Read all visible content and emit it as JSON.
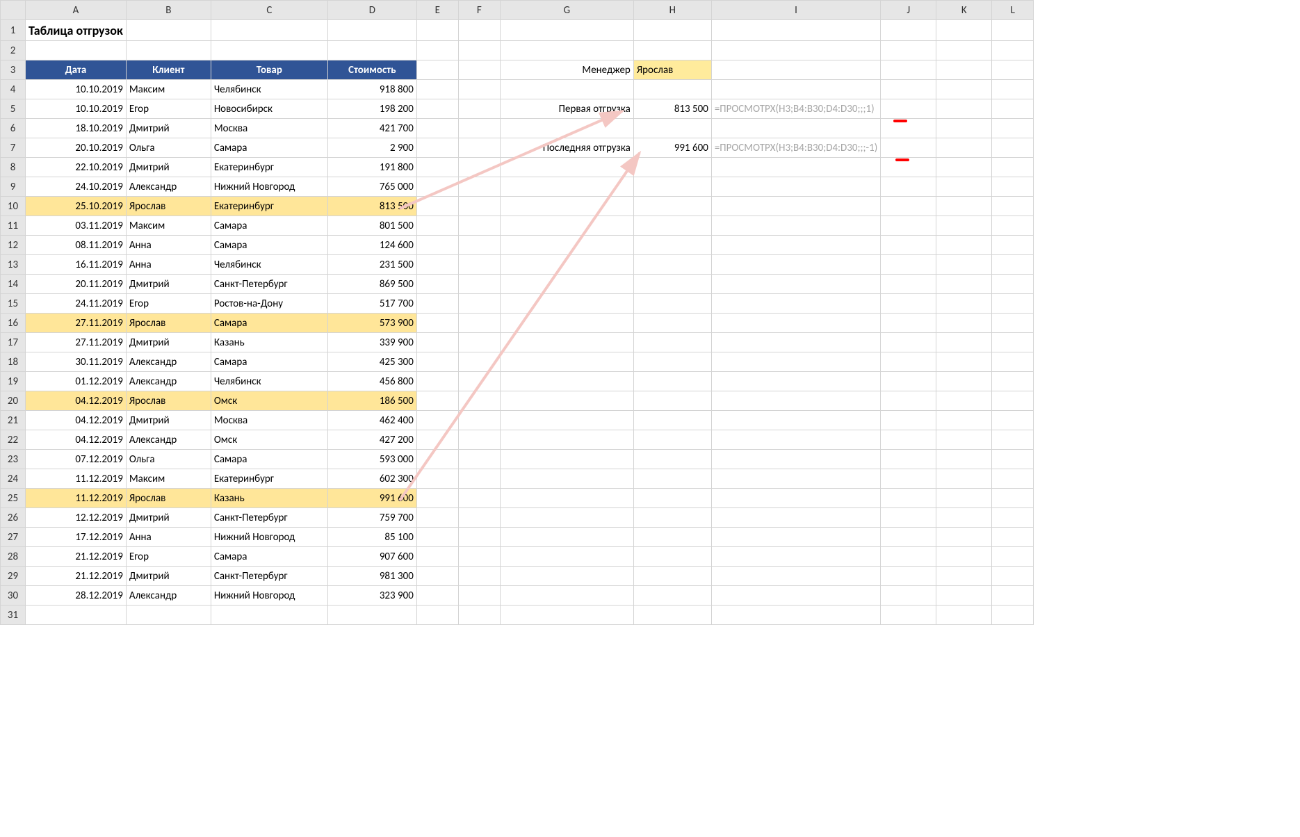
{
  "columns": [
    "A",
    "B",
    "C",
    "D",
    "E",
    "F",
    "G",
    "H",
    "I",
    "J",
    "K",
    "L"
  ],
  "title": "Таблица отгрузок",
  "headers": {
    "A": "Дата",
    "B": "Клиент",
    "C": "Товар",
    "D": "Стоимость"
  },
  "rows": [
    {
      "r": 4,
      "date": "10.10.2019",
      "client": "Максим",
      "product": "Челябинск",
      "cost": "918 800",
      "hl": false
    },
    {
      "r": 5,
      "date": "10.10.2019",
      "client": "Егор",
      "product": "Новосибирск",
      "cost": "198 200",
      "hl": false
    },
    {
      "r": 6,
      "date": "18.10.2019",
      "client": "Дмитрий",
      "product": "Москва",
      "cost": "421 700",
      "hl": false
    },
    {
      "r": 7,
      "date": "20.10.2019",
      "client": "Ольга",
      "product": "Самара",
      "cost": "2 900",
      "hl": false
    },
    {
      "r": 8,
      "date": "22.10.2019",
      "client": "Дмитрий",
      "product": "Екатеринбург",
      "cost": "191 800",
      "hl": false
    },
    {
      "r": 9,
      "date": "24.10.2019",
      "client": "Александр",
      "product": "Нижний Новгород",
      "cost": "765 000",
      "hl": false
    },
    {
      "r": 10,
      "date": "25.10.2019",
      "client": "Ярослав",
      "product": "Екатеринбург",
      "cost": "813 500",
      "hl": true
    },
    {
      "r": 11,
      "date": "03.11.2019",
      "client": "Максим",
      "product": "Самара",
      "cost": "801 500",
      "hl": false
    },
    {
      "r": 12,
      "date": "08.11.2019",
      "client": "Анна",
      "product": "Самара",
      "cost": "124 600",
      "hl": false
    },
    {
      "r": 13,
      "date": "16.11.2019",
      "client": "Анна",
      "product": "Челябинск",
      "cost": "231 500",
      "hl": false
    },
    {
      "r": 14,
      "date": "20.11.2019",
      "client": "Дмитрий",
      "product": "Санкт-Петербург",
      "cost": "869 500",
      "hl": false
    },
    {
      "r": 15,
      "date": "24.11.2019",
      "client": "Егор",
      "product": "Ростов-на-Дону",
      "cost": "517 700",
      "hl": false
    },
    {
      "r": 16,
      "date": "27.11.2019",
      "client": "Ярослав",
      "product": "Самара",
      "cost": "573 900",
      "hl": true
    },
    {
      "r": 17,
      "date": "27.11.2019",
      "client": "Дмитрий",
      "product": "Казань",
      "cost": "339 900",
      "hl": false
    },
    {
      "r": 18,
      "date": "30.11.2019",
      "client": "Александр",
      "product": "Самара",
      "cost": "425 300",
      "hl": false
    },
    {
      "r": 19,
      "date": "01.12.2019",
      "client": "Александр",
      "product": "Челябинск",
      "cost": "456 800",
      "hl": false
    },
    {
      "r": 20,
      "date": "04.12.2019",
      "client": "Ярослав",
      "product": "Омск",
      "cost": "186 500",
      "hl": true
    },
    {
      "r": 21,
      "date": "04.12.2019",
      "client": "Дмитрий",
      "product": "Москва",
      "cost": "462 400",
      "hl": false
    },
    {
      "r": 22,
      "date": "04.12.2019",
      "client": "Александр",
      "product": "Омск",
      "cost": "427 200",
      "hl": false
    },
    {
      "r": 23,
      "date": "07.12.2019",
      "client": "Ольга",
      "product": "Самара",
      "cost": "593 000",
      "hl": false
    },
    {
      "r": 24,
      "date": "11.12.2019",
      "client": "Максим",
      "product": "Екатеринбург",
      "cost": "602 300",
      "hl": false
    },
    {
      "r": 25,
      "date": "11.12.2019",
      "client": "Ярослав",
      "product": "Казань",
      "cost": "991 600",
      "hl": true
    },
    {
      "r": 26,
      "date": "12.12.2019",
      "client": "Дмитрий",
      "product": "Санкт-Петербург",
      "cost": "759 700",
      "hl": false
    },
    {
      "r": 27,
      "date": "17.12.2019",
      "client": "Анна",
      "product": "Нижний Новгород",
      "cost": "85 100",
      "hl": false
    },
    {
      "r": 28,
      "date": "21.12.2019",
      "client": "Егор",
      "product": "Самара",
      "cost": "907 600",
      "hl": false
    },
    {
      "r": 29,
      "date": "21.12.2019",
      "client": "Дмитрий",
      "product": "Санкт-Петербург",
      "cost": "981 300",
      "hl": false
    },
    {
      "r": 30,
      "date": "28.12.2019",
      "client": "Александр",
      "product": "Нижний Новгород",
      "cost": "323 900",
      "hl": false
    }
  ],
  "side": {
    "manager_label": "Менеджер",
    "manager_value": "Ярослав",
    "first_label": "Первая отгрузка",
    "first_value": "813 500",
    "first_formula": "=ПРОСМОТРX(H3;B4:B30;D4:D30;;;1)",
    "last_label": "Последняя отгрузка",
    "last_value": "991 600",
    "last_formula": "=ПРОСМОТРX(H3;B4:B30;D4:D30;;;-1)"
  }
}
